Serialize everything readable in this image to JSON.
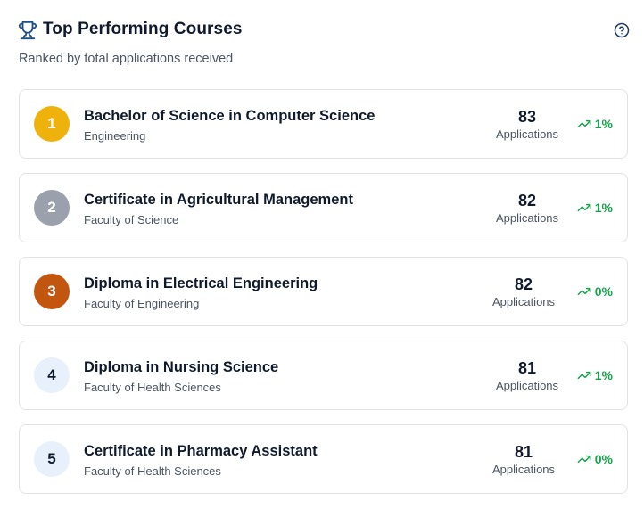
{
  "header": {
    "title": "Top Performing Courses",
    "subtitle": "Ranked by total applications received",
    "trophy_icon": "trophy-icon",
    "help_icon": "help-circle-icon"
  },
  "colors": {
    "gold": "#efb10b",
    "silver": "#9aa1ad",
    "bronze": "#c2560f",
    "neutral": "#e8f1fb",
    "trend_up": "#16a34a"
  },
  "courses": [
    {
      "rank": "1",
      "name": "Bachelor of Science in Computer Science",
      "faculty": "Engineering",
      "applications": "83",
      "applications_label": "Applications",
      "trend": "1%"
    },
    {
      "rank": "2",
      "name": "Certificate in Agricultural Management",
      "faculty": "Faculty of Science",
      "applications": "82",
      "applications_label": "Applications",
      "trend": "1%"
    },
    {
      "rank": "3",
      "name": "Diploma in Electrical Engineering",
      "faculty": "Faculty of Engineering",
      "applications": "82",
      "applications_label": "Applications",
      "trend": "0%"
    },
    {
      "rank": "4",
      "name": "Diploma in Nursing Science",
      "faculty": "Faculty of Health Sciences",
      "applications": "81",
      "applications_label": "Applications",
      "trend": "1%"
    },
    {
      "rank": "5",
      "name": "Certificate in Pharmacy Assistant",
      "faculty": "Faculty of Health Sciences",
      "applications": "81",
      "applications_label": "Applications",
      "trend": "0%"
    }
  ]
}
